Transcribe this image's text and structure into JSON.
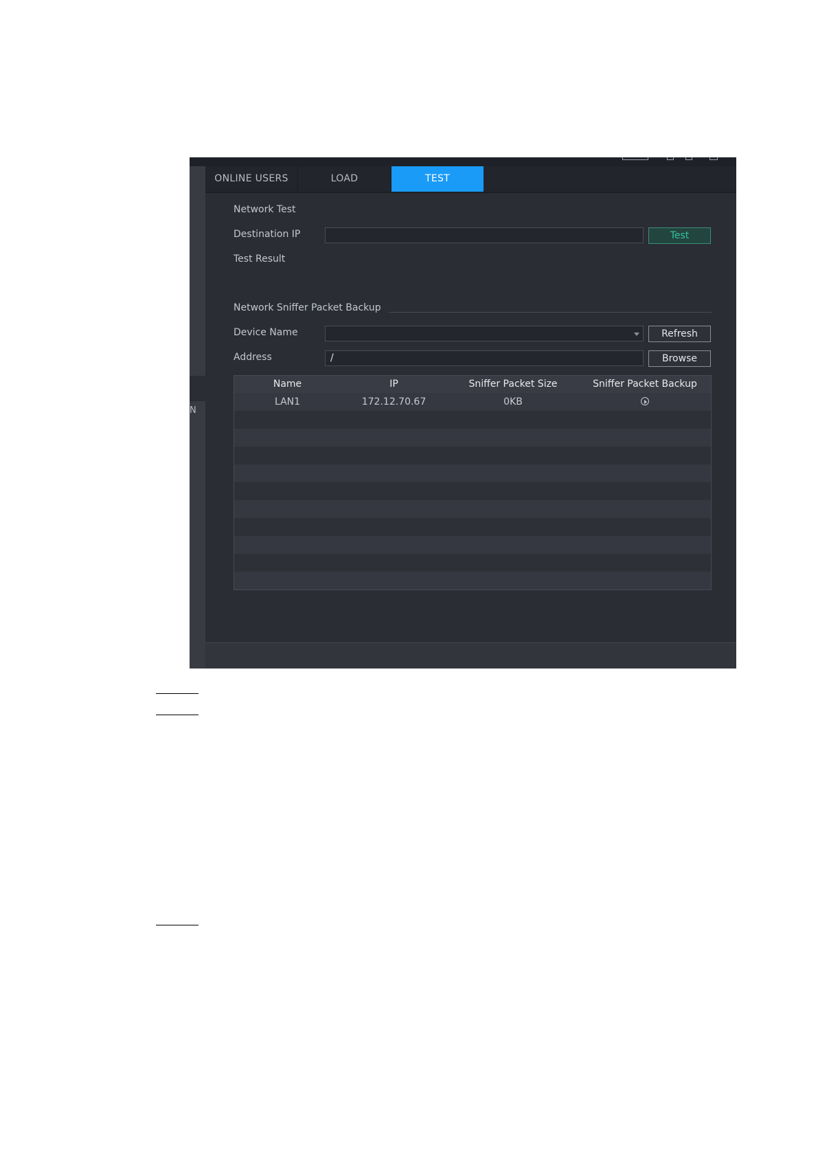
{
  "tabs": [
    {
      "label": "ONLINE USERS",
      "active": false
    },
    {
      "label": "LOAD",
      "active": false
    },
    {
      "label": "TEST",
      "active": true
    }
  ],
  "network_test": {
    "section_title": "Network Test",
    "destination_ip_label": "Destination IP",
    "destination_ip_value": "",
    "test_button": "Test",
    "test_result_label": "Test Result"
  },
  "sniffer": {
    "section_title": "Network Sniffer Packet Backup",
    "device_name_label": "Device Name",
    "device_name_value": "",
    "refresh_button": "Refresh",
    "address_label": "Address",
    "address_value": "/",
    "browse_button": "Browse",
    "table": {
      "columns": [
        "Name",
        "IP",
        "Sniffer Packet Size",
        "Sniffer Packet Backup"
      ],
      "rows": [
        {
          "name": "LAN1",
          "ip": "172.12.70.67",
          "size": "0KB",
          "backup_icon": "play-circle-icon"
        }
      ]
    }
  },
  "colors": {
    "accent": "#1a9bf7",
    "test_button_text": "#36c39b",
    "background": "#2b2d35"
  }
}
